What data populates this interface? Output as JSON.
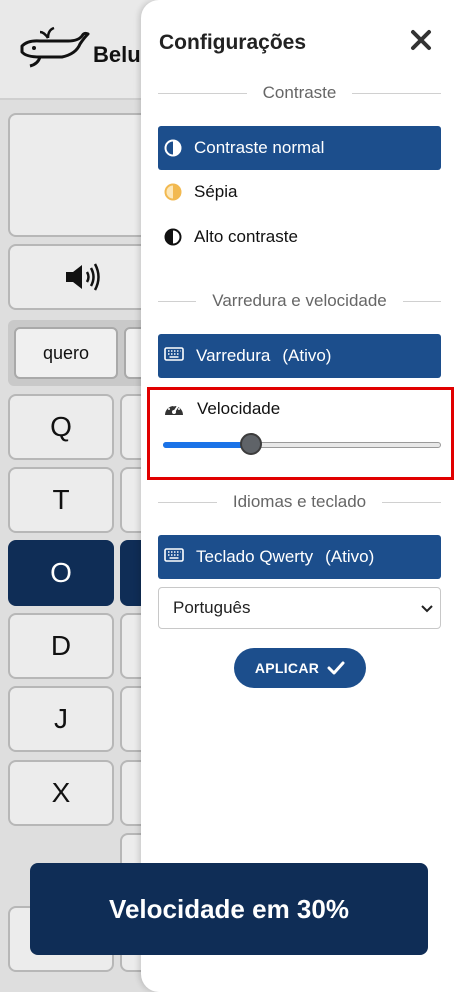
{
  "app": {
    "brand": "Belu"
  },
  "keyboard": {
    "suggestions": [
      "quero"
    ],
    "keys": [
      "Q",
      "T",
      "O",
      "D",
      "J",
      "X"
    ]
  },
  "settings": {
    "title": "Configurações",
    "contrast_section": "Contraste",
    "contrast_options": [
      "Contraste normal",
      "Sépia",
      "Alto contraste"
    ],
    "scan_section": "Varredura e velocidade",
    "scan_button": {
      "label": "Varredura",
      "status": "(Ativo)"
    },
    "speed": {
      "label": "Velocidade",
      "value_percent": 30
    },
    "lang_section": "Idiomas e teclado",
    "keyboard_button": {
      "label": "Teclado Qwerty",
      "status": "(Ativo)"
    },
    "language_select": {
      "selected": "Português"
    },
    "apply_label": "APLICAR"
  },
  "toast": {
    "message": "Velocidade em 30%"
  },
  "colors": {
    "accent": "#1c4e8c",
    "dark_key": "#0f2d56",
    "highlight": "#e10000",
    "sepia": "#f2b950"
  },
  "icons": [
    "whale-logo-icon",
    "speaker-icon",
    "close-icon",
    "contrast-icon",
    "keyboard-icon",
    "speedometer-icon",
    "chevron-down-icon",
    "check-icon"
  ]
}
